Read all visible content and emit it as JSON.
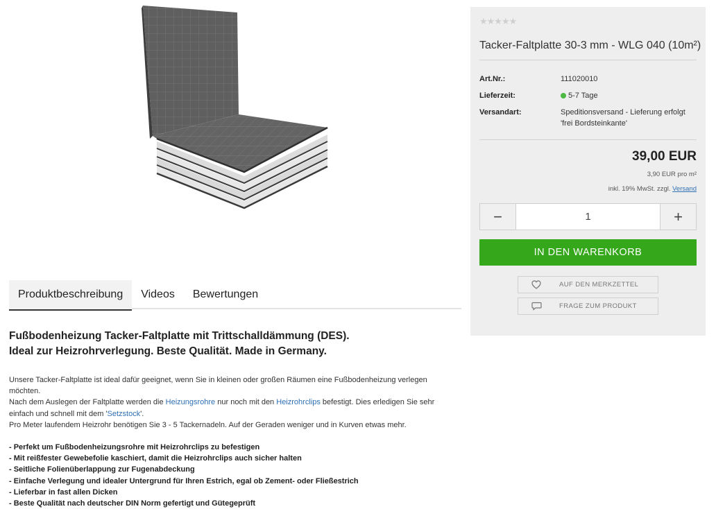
{
  "tabs": [
    "Produktbeschreibung",
    "Videos",
    "Bewertungen"
  ],
  "description": {
    "heading_line1": "Fußbodenheizung Tacker-Faltplatte mit Trittschalldämmung (DES).",
    "heading_line2": "Ideal zur Heizrohrverlegung. Beste Qualität. Made in Germany.",
    "p1": "Unsere Tacker-Faltplatte ist ideal dafür geeignet, wenn Sie in kleinen oder großen Räumen eine Fußbodenheizung verlegen möchten.",
    "p2_a": "Nach dem Auslegen der Faltplatte werden die ",
    "p2_link1": "Heizungsrohre",
    "p2_b": " nur noch mit den ",
    "p2_link2": "Heizrohrclips",
    "p2_c": " befestigt. Dies erledigen Sie sehr einfach und schnell mit dem '",
    "p2_link3": "Setzstock",
    "p2_d": "'.",
    "p3": "Pro Meter laufendem Heizrohr benötigen Sie 3 - 5 Tackernadeln. Auf der Geraden weniger und in Kurven etwas mehr.",
    "bullets": [
      "- Perfekt um Fußbodenheizungsrohre mit Heizrohrclips zu befestigen",
      "- Mit reißfester Gewebefolie kaschiert, damit die Heizrohrclips auch sicher halten",
      "- Seitliche Folienüberlappung zur Fugenabdeckung",
      "- Einfache Verlegung und idealer Untergrund für Ihren Estrich, egal ob Zement- oder Fließestrich",
      "- Lieferbar in fast allen Dicken",
      "- Beste Qualität nach deutscher DIN Norm gefertigt und Gütegeprüft"
    ]
  },
  "product": {
    "stars": "★★★★★",
    "rating": 0,
    "title": "Tacker-Faltplatte 30-3 mm - WLG 040 (10m²)",
    "props": [
      {
        "label": "Art.Nr.:",
        "value": "111020010"
      },
      {
        "label": "Lieferzeit:",
        "value": "5-7 Tage",
        "status_color": "#4cb944"
      },
      {
        "label": "Versandart:",
        "value": "Speditionsversand - Lieferung erfolgt 'frei Bordsteinkante'"
      }
    ],
    "price": "39,00 EUR",
    "unit_price": "3,90 EUR pro m²",
    "tax_text": "inkl. 19% MwSt. zzgl. ",
    "tax_link": "Versand",
    "quantity": "1",
    "minus_icon": "−",
    "plus_icon": "+",
    "cart_button": "In den Warenkorb",
    "wishlist_button": "Auf den Merkzettel",
    "question_button": "Frage zum Produkt"
  },
  "colors": {
    "accent_green": "#34a81a",
    "link_blue": "#2f6fb3",
    "panel_bg": "#eeeeee"
  },
  "icons": {
    "wishlist": "heart-icon",
    "question": "speech-bubble-icon"
  }
}
